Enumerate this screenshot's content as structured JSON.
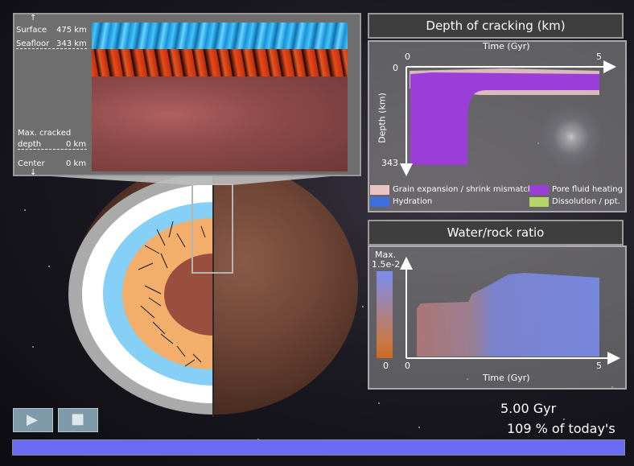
{
  "detail": {
    "surface_label": "Surface",
    "surface_value": "475 km",
    "seafloor_label": "Seafloor",
    "seafloor_value": "343 km",
    "cracked_label": "Max. cracked",
    "cracked_label2": "depth",
    "cracked_value": "0 km",
    "center_label": "Center",
    "center_value": "0 km",
    "arrow_up": "↑",
    "arrow_down": "↓"
  },
  "cracking_panel": {
    "title": "Depth of cracking (km)",
    "x_title": "Time (Gyr)",
    "x_start": "0",
    "x_end": "5",
    "y_title": "Depth (km)",
    "y_start": "0",
    "y_end": "343",
    "legend": [
      {
        "label": "Grain expansion / shrink mismatch",
        "color": "#e8c4c4"
      },
      {
        "label": "Pore fluid heating",
        "color": "#9b3ed8"
      },
      {
        "label": "Hydration",
        "color": "#3b6fe0"
      },
      {
        "label": "Dissolution / ppt.",
        "color": "#b6d46a"
      }
    ]
  },
  "water_panel": {
    "title": "Water/rock ratio",
    "scale_max_label": "Max.",
    "scale_max_value": "1.5e-2",
    "scale_min_value": "0",
    "x_start": "0",
    "x_end": "5",
    "x_title": "Time (Gyr)"
  },
  "status": {
    "time_value": "5.00",
    "time_unit": "Gyr",
    "age_value": "109",
    "age_text": "% of today's age"
  },
  "controls": {
    "play_icon": "▶",
    "stop_icon": "■",
    "progress": 1.0,
    "progress_color": "#6a6af2"
  }
}
